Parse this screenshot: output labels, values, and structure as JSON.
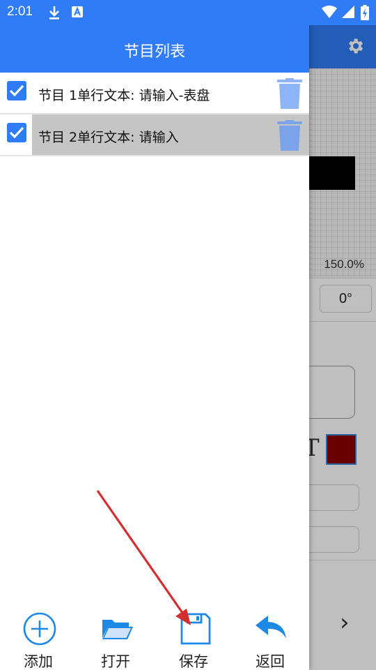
{
  "status_bar": {
    "time": "2:01",
    "left_icons": [
      "download-icon",
      "font-icon"
    ],
    "right_icons": [
      "wifi-icon",
      "signal-icon",
      "battery-icon"
    ]
  },
  "drawer": {
    "title": "节目列表",
    "programs": [
      {
        "label": "节目 1单行文本: 请输入-表盘",
        "checked": true,
        "selected": false
      },
      {
        "label": "节目 2单行文本: 请输入",
        "checked": true,
        "selected": true
      }
    ]
  },
  "toolbar": {
    "add_label": "添加",
    "open_label": "打开",
    "save_label": "保存",
    "back_label": "返回"
  },
  "background_app": {
    "zoom": "150.0%",
    "rotation": "0°",
    "text_icon": "T",
    "color_swatch": "#8b0000"
  },
  "colors": {
    "primary": "#2f7cf6",
    "icon_blue": "#1e88e5",
    "trash": "#8cb4f6",
    "annotation": "#d32f2f"
  }
}
